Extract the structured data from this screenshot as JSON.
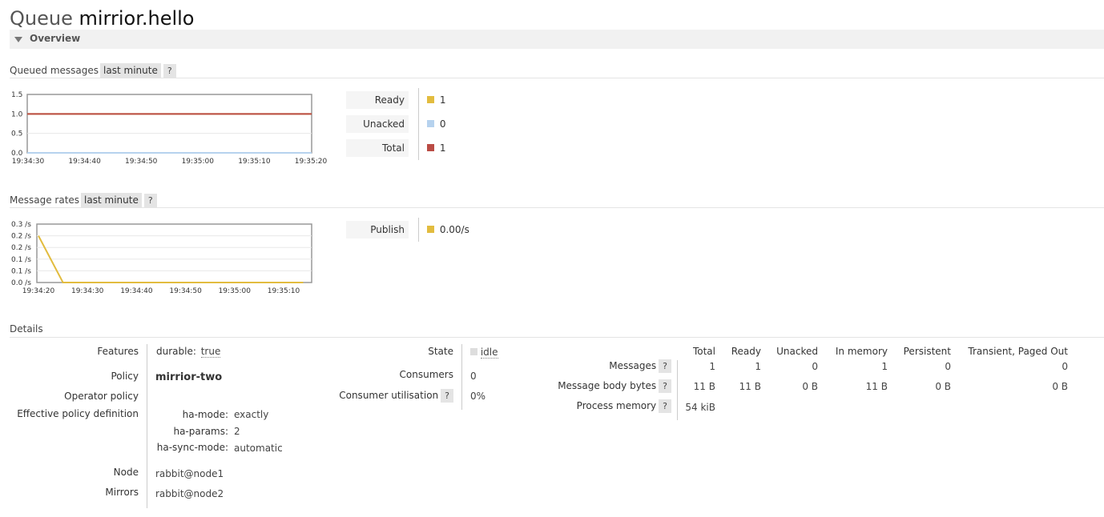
{
  "header": {
    "prefix": "Queue",
    "queue_name": "mirrior.hello"
  },
  "overview": {
    "label": "Overview"
  },
  "queued": {
    "title": "Queued messages",
    "range": "last minute",
    "help": "?",
    "legend": [
      {
        "label": "Ready",
        "value": "1",
        "color": "#e2bc3f"
      },
      {
        "label": "Unacked",
        "value": "0",
        "color": "#b6d2ee"
      },
      {
        "label": "Total",
        "value": "1",
        "color": "#ba4c45"
      }
    ]
  },
  "rates": {
    "title": "Message rates",
    "range": "last minute",
    "help": "?",
    "legend": [
      {
        "label": "Publish",
        "value": "0.00/s",
        "color": "#e2bc3f"
      }
    ]
  },
  "chart_data": [
    {
      "type": "line",
      "x": [
        "19:34:30",
        "19:34:40",
        "19:34:50",
        "19:35:00",
        "19:35:10",
        "19:35:20"
      ],
      "yticks": [
        "0.0",
        "0.5",
        "1.0",
        "1.5"
      ],
      "ylim": [
        0,
        1.5
      ],
      "series": [
        {
          "name": "Ready",
          "values": [
            1,
            1,
            1,
            1,
            1,
            1
          ],
          "color": "#e2bc3f"
        },
        {
          "name": "Unacked",
          "values": [
            0,
            0,
            0,
            0,
            0,
            0
          ],
          "color": "#b6d2ee"
        },
        {
          "name": "Total",
          "values": [
            1,
            1,
            1,
            1,
            1,
            1
          ],
          "color": "#ba4c45"
        }
      ]
    },
    {
      "type": "line",
      "x": [
        "19:34:20",
        "19:34:30",
        "19:34:40",
        "19:34:50",
        "19:35:00",
        "19:35:10"
      ],
      "yticks": [
        "0.0 /s",
        "0.1 /s",
        "0.1 /s",
        "0.2 /s",
        "0.2 /s",
        "0.3 /s"
      ],
      "ylim": [
        0,
        0.25
      ],
      "series": [
        {
          "name": "Publish",
          "points": [
            [
              0,
              0.2
            ],
            [
              0.5,
              0
            ],
            [
              1,
              0
            ],
            [
              2,
              0
            ],
            [
              3,
              0
            ],
            [
              4,
              0
            ],
            [
              5,
              0
            ],
            [
              5.4,
              0
            ]
          ],
          "color": "#e2bc3f"
        }
      ]
    }
  ],
  "details": {
    "title": "Details",
    "features_label": "Features",
    "features_key": "durable:",
    "features_val": "true",
    "policy_label": "Policy",
    "policy_val": "mirrior-two",
    "operator_policy_label": "Operator policy",
    "effective_label": "Effective policy definition",
    "effective": [
      {
        "k": "ha-mode:",
        "v": "exactly"
      },
      {
        "k": "ha-params:",
        "v": "2"
      },
      {
        "k": "ha-sync-mode:",
        "v": "automatic"
      }
    ],
    "node_label": "Node",
    "node_val": "rabbit@node1",
    "mirrors_label": "Mirrors",
    "mirrors_val": "rabbit@node2",
    "state_label": "State",
    "state_val": "idle",
    "consumers_label": "Consumers",
    "consumers_val": "0",
    "util_label": "Consumer utilisation",
    "util_val": "0%",
    "stats": {
      "columns": [
        "Total",
        "Ready",
        "Unacked",
        "In memory",
        "Persistent",
        "Transient, Paged Out"
      ],
      "rows": [
        {
          "label": "Messages",
          "values": [
            "1",
            "1",
            "0",
            "1",
            "0",
            "0"
          ]
        },
        {
          "label": "Message body bytes",
          "values": [
            "11 B",
            "11 B",
            "0 B",
            "11 B",
            "0 B",
            "0 B"
          ]
        },
        {
          "label": "Process memory",
          "values": [
            "54 kiB",
            "",
            "",
            "",
            "",
            ""
          ]
        }
      ]
    }
  }
}
